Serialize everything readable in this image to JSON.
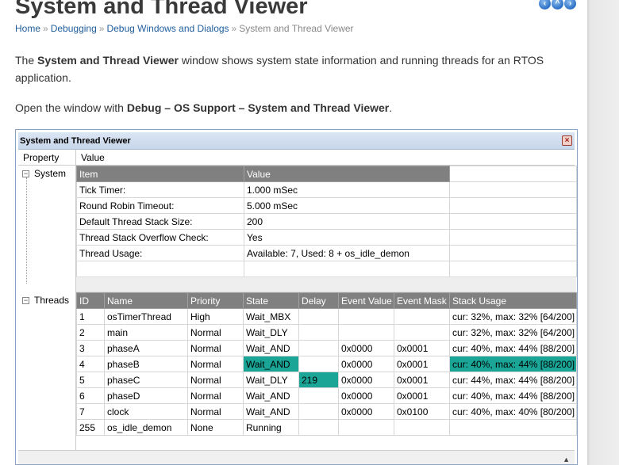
{
  "page": {
    "title": "System and Thread Viewer",
    "breadcrumb": [
      "Home",
      "Debugging",
      "Debug Windows and Dialogs",
      "System and Thread Viewer"
    ],
    "breadcrumb_sep": "»",
    "nav_icons": [
      "back-icon",
      "up-icon",
      "forward-icon"
    ],
    "para1_pre": "The ",
    "para1_bold": "System and Thread Viewer",
    "para1_post": " window shows system state information and running threads for an RTOS application.",
    "para2_pre": "Open the window with ",
    "para2_bold": "Debug – OS Support – System and Thread Viewer",
    "para2_post": "."
  },
  "window": {
    "title": "System and Thread Viewer",
    "close_glyph": "×",
    "col_property": "Property",
    "col_value": "Value",
    "system_label": "System",
    "threads_label": "Threads",
    "system_table": {
      "headers": [
        "Item",
        "Value"
      ],
      "rows": [
        [
          "Tick Timer:",
          "1.000 mSec"
        ],
        [
          "Round Robin Timeout:",
          "5.000 mSec"
        ],
        [
          "Default Thread Stack Size:",
          "200"
        ],
        [
          "Thread Stack Overflow Check:",
          "Yes"
        ],
        [
          "Thread Usage:",
          "Available: 7, Used: 8 + os_idle_demon"
        ]
      ]
    },
    "threads_table": {
      "headers": [
        "ID",
        "Name",
        "Priority",
        "State",
        "Delay",
        "Event Value",
        "Event Mask",
        "Stack Usage"
      ],
      "rows": [
        [
          "1",
          "osTimerThread",
          "High",
          "Wait_MBX",
          "",
          "",
          "",
          "cur: 32%, max: 32% [64/200]"
        ],
        [
          "2",
          "main",
          "Normal",
          "Wait_DLY",
          "",
          "",
          "",
          "cur: 32%, max: 32% [64/200]"
        ],
        [
          "3",
          "phaseA",
          "Normal",
          "Wait_AND",
          "",
          "0x0000",
          "0x0001",
          "cur: 40%, max: 44% [88/200]"
        ],
        [
          "4",
          "phaseB",
          "Normal",
          "Wait_AND",
          "",
          "0x0000",
          "0x0001",
          "cur: 40%, max: 44% [88/200]"
        ],
        [
          "5",
          "phaseC",
          "Normal",
          "Wait_DLY",
          "219",
          "0x0000",
          "0x0001",
          "cur: 44%, max: 44% [88/200]"
        ],
        [
          "6",
          "phaseD",
          "Normal",
          "Wait_AND",
          "",
          "0x0000",
          "0x0001",
          "cur: 40%, max: 44% [88/200]"
        ],
        [
          "7",
          "clock",
          "Normal",
          "Wait_AND",
          "",
          "0x0000",
          "0x0100",
          "cur: 40%, max: 40% [80/200]"
        ],
        [
          "255",
          "os_idle_demon",
          "None",
          "Running",
          "",
          "",
          "",
          ""
        ]
      ],
      "highlight_color": "#1aa596"
    }
  }
}
